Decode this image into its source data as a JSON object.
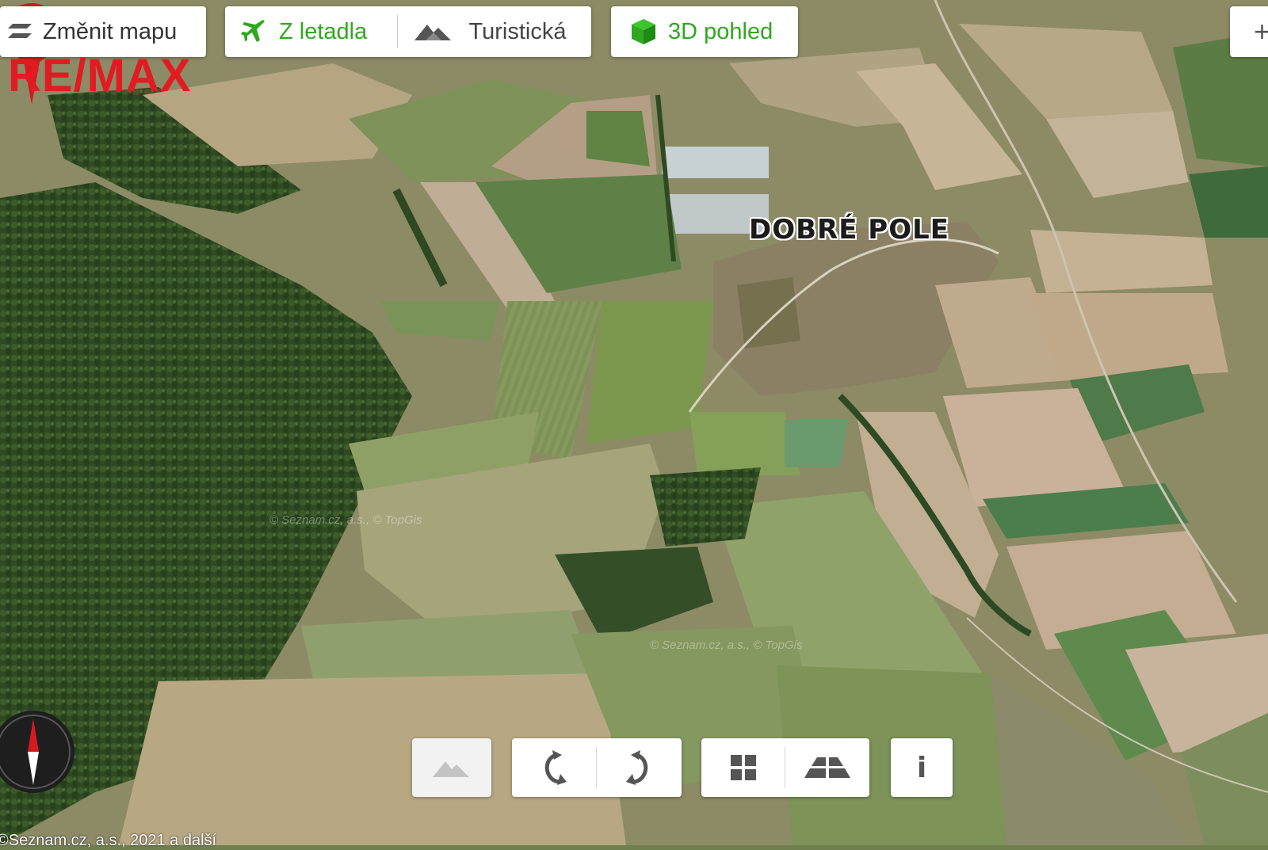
{
  "toolbar": {
    "change_map_label": "Změnit mapu",
    "aerial_label": "Z letadla",
    "tourist_label": "Turistická",
    "view3d_label": "3D pohled",
    "right_button_label": "+"
  },
  "brand": {
    "logo_text": "RE/MAX",
    "logo_color": "#e11b22"
  },
  "map": {
    "place_name": "DOBRÉ POLE",
    "watermark": "© Seznam.cz, a.s., © TopGis",
    "accent_color": "#2fa81f",
    "pin_color": "#d7191f"
  },
  "controls": {
    "terrain_icon": "terrain-icon",
    "rotate_left_icon": "rotate-left-icon",
    "rotate_right_icon": "rotate-right-icon",
    "grid_icon": "grid-view-icon",
    "tilt_icon": "tilt-view-icon",
    "info_label": "i"
  },
  "footer": {
    "copyright": "©Seznam.cz, a.s., 2021 a další"
  }
}
